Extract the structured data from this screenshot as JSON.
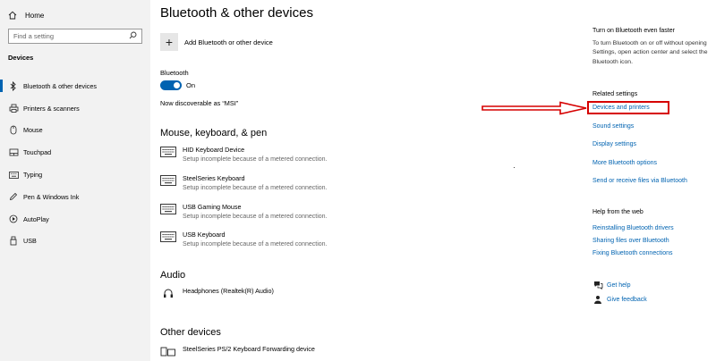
{
  "sidebar": {
    "home_label": "Home",
    "search_placeholder": "Find a setting",
    "section_label": "Devices",
    "items": [
      {
        "label": "Bluetooth & other devices",
        "icon": "bluetooth-icon",
        "active": true
      },
      {
        "label": "Printers & scanners",
        "icon": "printer-icon"
      },
      {
        "label": "Mouse",
        "icon": "mouse-icon"
      },
      {
        "label": "Touchpad",
        "icon": "touchpad-icon"
      },
      {
        "label": "Typing",
        "icon": "keyboard-icon"
      },
      {
        "label": "Pen & Windows Ink",
        "icon": "pen-icon"
      },
      {
        "label": "AutoPlay",
        "icon": "autoplay-icon"
      },
      {
        "label": "USB",
        "icon": "usb-icon"
      }
    ]
  },
  "main": {
    "title": "Bluetooth & other devices",
    "add_device_label": "Add Bluetooth or other device",
    "bluetooth_label": "Bluetooth",
    "toggle_state": "On",
    "discoverable_text": "Now discoverable as “MSI”",
    "mouse_section": {
      "heading": "Mouse, keyboard, & pen",
      "devices": [
        {
          "name": "HID Keyboard Device",
          "status": "Setup incomplete because of a metered connection."
        },
        {
          "name": "SteelSeries Keyboard",
          "status": "Setup incomplete because of a metered connection."
        },
        {
          "name": "USB Gaming Mouse",
          "status": "Setup incomplete because of a metered connection."
        },
        {
          "name": "USB Keyboard",
          "status": "Setup incomplete because of a metered connection."
        }
      ]
    },
    "audio_section": {
      "heading": "Audio",
      "devices": [
        {
          "name": "Headphones (Realtek(R) Audio)",
          "status": ""
        }
      ]
    },
    "other_section": {
      "heading": "Other devices",
      "devices": [
        {
          "name": "SteelSeries PS/2 Keyboard Forwarding device",
          "status": ""
        }
      ]
    }
  },
  "right_panel": {
    "tip_title": "Turn on Bluetooth even faster",
    "tip_text": "To turn Bluetooth on or off without opening Settings, open action center and select the Bluetooth icon.",
    "related_title": "Related settings",
    "related_links": [
      "Devices and printers",
      "Sound settings",
      "Display settings",
      "More Bluetooth options",
      "Send or receive files via Bluetooth"
    ],
    "help_title": "Help from the web",
    "help_links": [
      "Reinstalling Bluetooth drivers",
      "Sharing files over Bluetooth",
      "Fixing Bluetooth connections"
    ],
    "get_help": "Get help",
    "give_feedback": "Give feedback"
  },
  "colors": {
    "accent": "#0063b1",
    "annotation": "#d60000",
    "sidebar_bg": "#f2f2f2"
  }
}
